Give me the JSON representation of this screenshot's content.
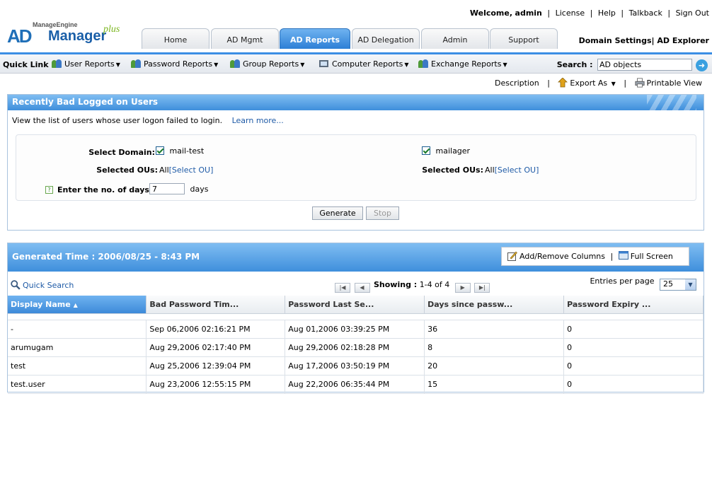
{
  "brand": {
    "vendor": "ManageEngine",
    "product_a": "AD",
    "product_b": "Manager",
    "suffix": "plus"
  },
  "top_links": {
    "welcome": "Welcome,",
    "user": "admin",
    "license": "License",
    "help": "Help",
    "talkback": "Talkback",
    "signout": "Sign Out"
  },
  "domain_links": {
    "domain_settings": "Domain Settings",
    "ad_explorer": "AD Explorer"
  },
  "tabs": [
    {
      "label": "Home"
    },
    {
      "label": "AD Mgmt"
    },
    {
      "label": "AD Reports"
    },
    {
      "label": "AD Delegation"
    },
    {
      "label": "Admin"
    },
    {
      "label": "Support"
    }
  ],
  "active_tab": "AD Reports",
  "quick_links": {
    "label": "Quick Link :",
    "items": [
      {
        "label": "User Reports",
        "icon": "users-icon"
      },
      {
        "label": "Password Reports",
        "icon": "password-users-icon"
      },
      {
        "label": "Group Reports",
        "icon": "group-icon"
      },
      {
        "label": "Computer Reports",
        "icon": "computer-icon"
      },
      {
        "label": "Exchange Reports",
        "icon": "exchange-icon"
      }
    ]
  },
  "search": {
    "label": "Search :",
    "value": "AD objects"
  },
  "actions": {
    "description": "Description",
    "export": "Export As",
    "print": "Printable View"
  },
  "report": {
    "title": "Recently Bad Logged on Users",
    "description": "View the list of users whose user logon failed to login.",
    "learn_more": "Learn more...",
    "select_domain_label": "Select Domain:",
    "domains": [
      {
        "name": "mail-test",
        "checked": true,
        "ous_label": "Selected OUs:",
        "ous_value": "All",
        "select_ou": "[Select OU]"
      },
      {
        "name": "mailager",
        "checked": true,
        "ous_label": "Selected OUs:",
        "ous_value": "All",
        "select_ou": "[Select OU]"
      }
    ],
    "days_label": "Enter the no. of days :",
    "days_value": "7",
    "days_unit": "days",
    "generate": "Generate",
    "stop": "Stop"
  },
  "results": {
    "generated_time": "Generated Time : 2006/08/25 - 8:43 PM",
    "add_remove_columns": "Add/Remove Columns",
    "full_screen": "Full Screen",
    "quick_search": "Quick Search",
    "showing_label": "Showing :",
    "showing_range": "1-4 of 4",
    "entries_label": "Entries per page",
    "entries_value": "25",
    "columns": [
      "Display Name",
      "Bad Password Tim...",
      "Password Last Se...",
      "Days since passw...",
      "Password Expiry ..."
    ],
    "rows": [
      [
        "-",
        "Sep 06,2006 02:16:21 PM",
        "Aug 01,2006 03:39:25 PM",
        "36",
        "0"
      ],
      [
        "arumugam",
        "Aug 29,2006 02:17:40 PM",
        "Aug 29,2006 02:18:28 PM",
        "8",
        "0"
      ],
      [
        "test",
        "Aug 25,2006 12:39:04 PM",
        "Aug 17,2006 03:50:19 PM",
        "20",
        "0"
      ],
      [
        "test.user",
        "Aug 23,2006 12:55:15 PM",
        "Aug 22,2006 06:35:44 PM",
        "15",
        "0"
      ]
    ]
  }
}
